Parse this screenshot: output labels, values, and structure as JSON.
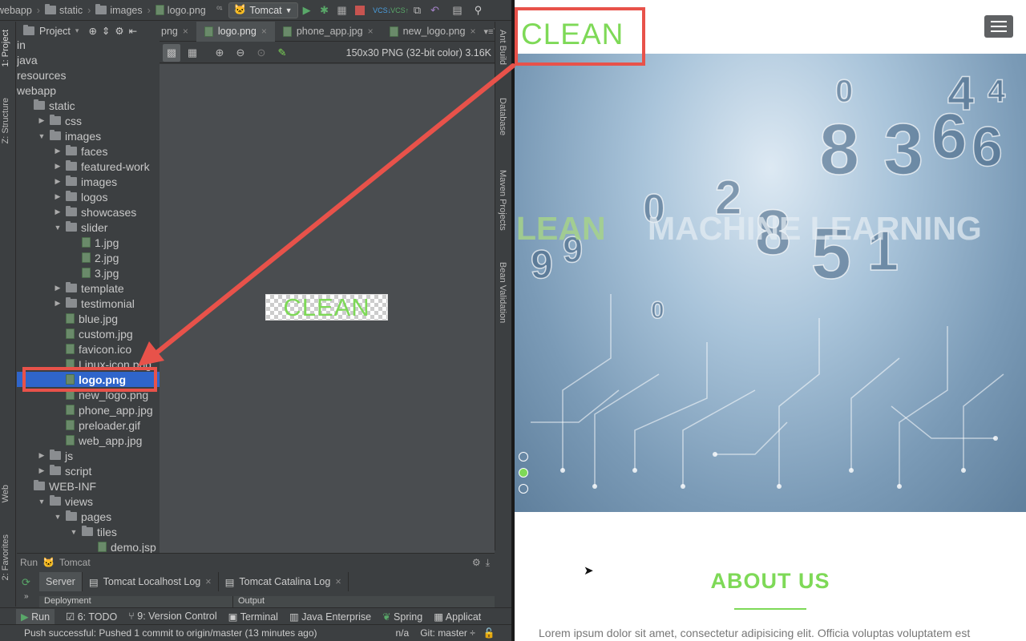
{
  "breadcrumb": {
    "items": [
      "webapp",
      "static",
      "images",
      "logo.png"
    ]
  },
  "toolbar": {
    "run_config": "Tomcat"
  },
  "project_panel": {
    "title": "Project"
  },
  "side_tabs_left": [
    "1: Project",
    "Z: Structure",
    "Web",
    "2: Favorites"
  ],
  "side_tabs_right": [
    "Ant Build",
    "Database",
    "Maven Projects",
    "Bean Validation"
  ],
  "tree": [
    {
      "label": "in",
      "depth": 0,
      "type": "none"
    },
    {
      "label": "java",
      "depth": 0,
      "type": "none"
    },
    {
      "label": "resources",
      "depth": 0,
      "type": "none"
    },
    {
      "label": "webapp",
      "depth": 0,
      "type": "none"
    },
    {
      "label": "static",
      "depth": 0,
      "type": "folder",
      "arrow": ""
    },
    {
      "label": "css",
      "depth": 1,
      "type": "folder",
      "arrow": "▶"
    },
    {
      "label": "images",
      "depth": 1,
      "type": "folder",
      "arrow": "▼"
    },
    {
      "label": "faces",
      "depth": 2,
      "type": "folder",
      "arrow": "▶"
    },
    {
      "label": "featured-work",
      "depth": 2,
      "type": "folder",
      "arrow": "▶"
    },
    {
      "label": "images",
      "depth": 2,
      "type": "folder",
      "arrow": "▶"
    },
    {
      "label": "logos",
      "depth": 2,
      "type": "folder",
      "arrow": "▶"
    },
    {
      "label": "showcases",
      "depth": 2,
      "type": "folder",
      "arrow": "▶"
    },
    {
      "label": "slider",
      "depth": 2,
      "type": "folder",
      "arrow": "▼"
    },
    {
      "label": "1.jpg",
      "depth": 3,
      "type": "file"
    },
    {
      "label": "2.jpg",
      "depth": 3,
      "type": "file"
    },
    {
      "label": "3.jpg",
      "depth": 3,
      "type": "file"
    },
    {
      "label": "template",
      "depth": 2,
      "type": "folder",
      "arrow": "▶"
    },
    {
      "label": "testimonial",
      "depth": 2,
      "type": "folder",
      "arrow": "▶"
    },
    {
      "label": "blue.jpg",
      "depth": 2,
      "type": "file"
    },
    {
      "label": "custom.jpg",
      "depth": 2,
      "type": "file"
    },
    {
      "label": "favicon.ico",
      "depth": 2,
      "type": "file"
    },
    {
      "label": "Linux-icon.png",
      "depth": 2,
      "type": "file"
    },
    {
      "label": "logo.png",
      "depth": 2,
      "type": "file",
      "selected": true
    },
    {
      "label": "new_logo.png",
      "depth": 2,
      "type": "file"
    },
    {
      "label": "phone_app.jpg",
      "depth": 2,
      "type": "file"
    },
    {
      "label": "preloader.gif",
      "depth": 2,
      "type": "file"
    },
    {
      "label": "web_app.jpg",
      "depth": 2,
      "type": "file"
    },
    {
      "label": "js",
      "depth": 1,
      "type": "folder",
      "arrow": "▶"
    },
    {
      "label": "script",
      "depth": 1,
      "type": "folder",
      "arrow": "▶"
    },
    {
      "label": "WEB-INF",
      "depth": 0,
      "type": "folder",
      "arrow": ""
    },
    {
      "label": "views",
      "depth": 1,
      "type": "folder",
      "arrow": "▼"
    },
    {
      "label": "pages",
      "depth": 2,
      "type": "folder",
      "arrow": "▼"
    },
    {
      "label": "tiles",
      "depth": 3,
      "type": "folder",
      "arrow": "▼"
    },
    {
      "label": "demo.jsp",
      "depth": 4,
      "type": "file"
    }
  ],
  "editor_tabs": [
    "png",
    "logo.png",
    "phone_app.jpg",
    "new_logo.png"
  ],
  "image_info": "150x30 PNG (32-bit color) 3.16K",
  "preview_text": "CLEAN",
  "run_panel": {
    "header": "Run",
    "config": "Tomcat",
    "tabs": [
      "Server",
      "Tomcat Localhost Log",
      "Tomcat Catalina Log"
    ],
    "columns": [
      "Deployment",
      "Output"
    ]
  },
  "bottom_tools": [
    "Run",
    "6: TODO",
    "9: Version Control",
    "Terminal",
    "Java Enterprise",
    "Spring",
    "Applicat"
  ],
  "status": {
    "message": "Push successful: Pushed 1 commit to origin/master (13 minutes ago)",
    "na": "n/a",
    "git": "Git: master ÷"
  },
  "website": {
    "logo": "CLEAN",
    "hero_left": "LEAN",
    "hero_right": "MACHINE LEARNING",
    "about_title": "ABOUT US",
    "about_text": "Lorem ipsum dolor sit amet, consectetur adipisicing elit. Officia voluptas voluptatem est",
    "slider_dots": 3,
    "active_dot": 1,
    "colors": {
      "accent": "#7ed957",
      "highlight": "#e8524a",
      "ide_bg": "#3c3f41",
      "selection": "#2f65ca"
    }
  }
}
